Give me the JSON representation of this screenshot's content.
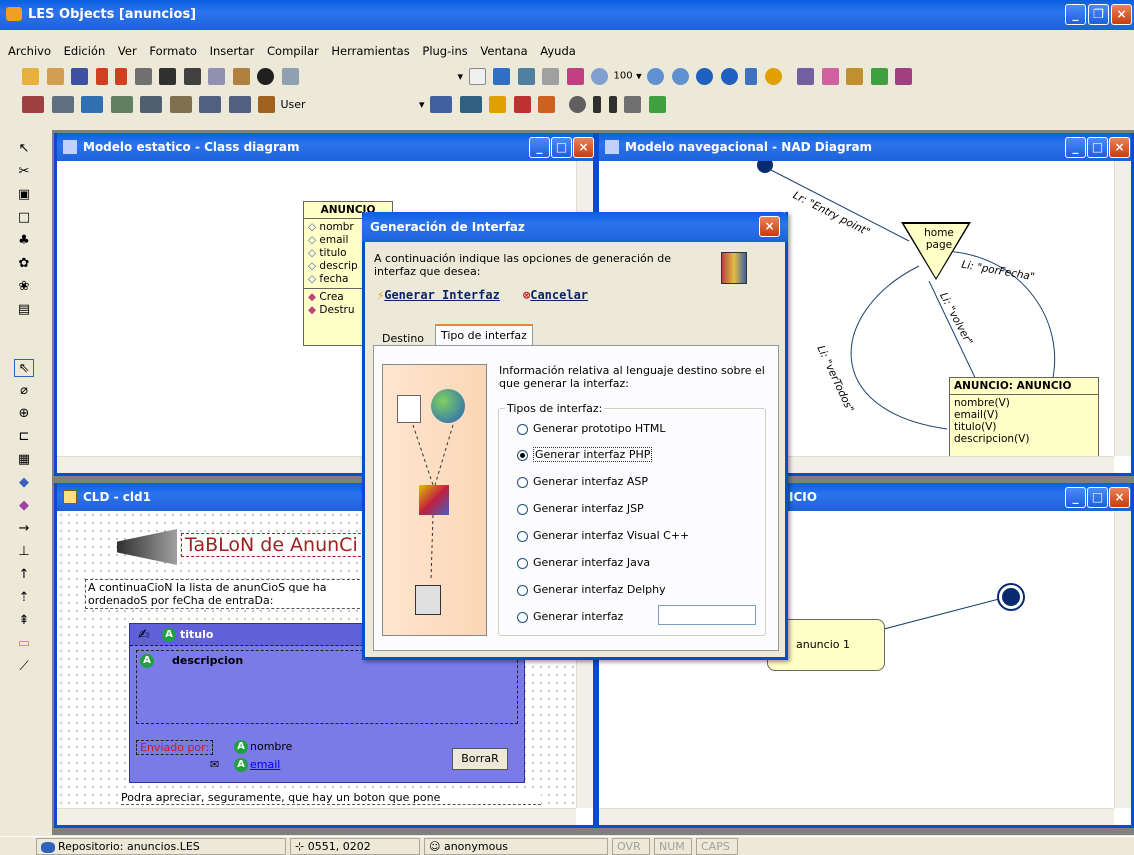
{
  "app": {
    "title": "LES Objects [anuncios]"
  },
  "menu": [
    "Archivo",
    "Edición",
    "Ver",
    "Formato",
    "Insertar",
    "Compilar",
    "Herramientas",
    "Plug-ins",
    "Ventana",
    "Ayuda"
  ],
  "toolbar": {
    "zoom": "100",
    "user": "User"
  },
  "windows": {
    "class_diagram": {
      "title": "Modelo estatico - Class diagram",
      "class_name": "ANUNCIO",
      "attributes": [
        "nombr",
        "email",
        "titulo",
        "descrip",
        "fecha"
      ],
      "operations": [
        "Crea",
        "Destru"
      ]
    },
    "nad": {
      "title": "Modelo navegacional - NAD Diagram",
      "link_entry": "Lr: \"Entry point\"",
      "node_home": "home page",
      "link_porfecha": "Li: \"porFecha\"",
      "link_volver": "Li: \"volver\"",
      "link_vertodos": "Li: \"verTodos\"",
      "class_title": "ANUNCIO: ANUNCIO",
      "class_attrs": [
        "nombre(V)",
        "email(V)",
        "titulo(V)",
        "descripcion(V)"
      ]
    },
    "cld": {
      "title": "CLD - cld1",
      "banner": "TaBLoN de AnunCi",
      "intro1": "A continuaCioN la lista de anunCioS que ha",
      "intro2": "ordenadoS por feCha de entraDa:",
      "f_titulo": "titulo",
      "f_descripcion": "descripcion",
      "enviado": "Enviado por:",
      "f_nombre": "nombre",
      "f_email": "email",
      "borrar": "BorraR",
      "footer": "Podra apreciar, seguramente, que hay un boton que pone"
    },
    "state": {
      "title": "ICIO",
      "node": "anuncio 1"
    }
  },
  "dialog": {
    "title": "Generación de Interfaz",
    "intro": "A continuación indique las opciones de generación de interfaz que desea:",
    "generar": "Generar Interfaz",
    "cancelar": "Cancelar",
    "tabs": [
      "Destino",
      "Tipo de interfaz"
    ],
    "info": "Información relativa al lenguaje destino sobre el que generar la interfaz:",
    "group": "Tipos de interfaz:",
    "options": [
      "Generar prototipo HTML",
      "Generar interfaz PHP",
      "Generar interfaz ASP",
      "Generar interfaz JSP",
      "Generar interfaz Visual C++",
      "Generar interfaz Java",
      "Generar interfaz Delphy",
      "Generar interfaz"
    ],
    "selected": 1
  },
  "status": {
    "repo": "Repositorio: anuncios.LES",
    "coords": "0551, 0202",
    "user": "anonymous",
    "ovr": "OVR",
    "num": "NUM",
    "caps": "CAPS"
  }
}
